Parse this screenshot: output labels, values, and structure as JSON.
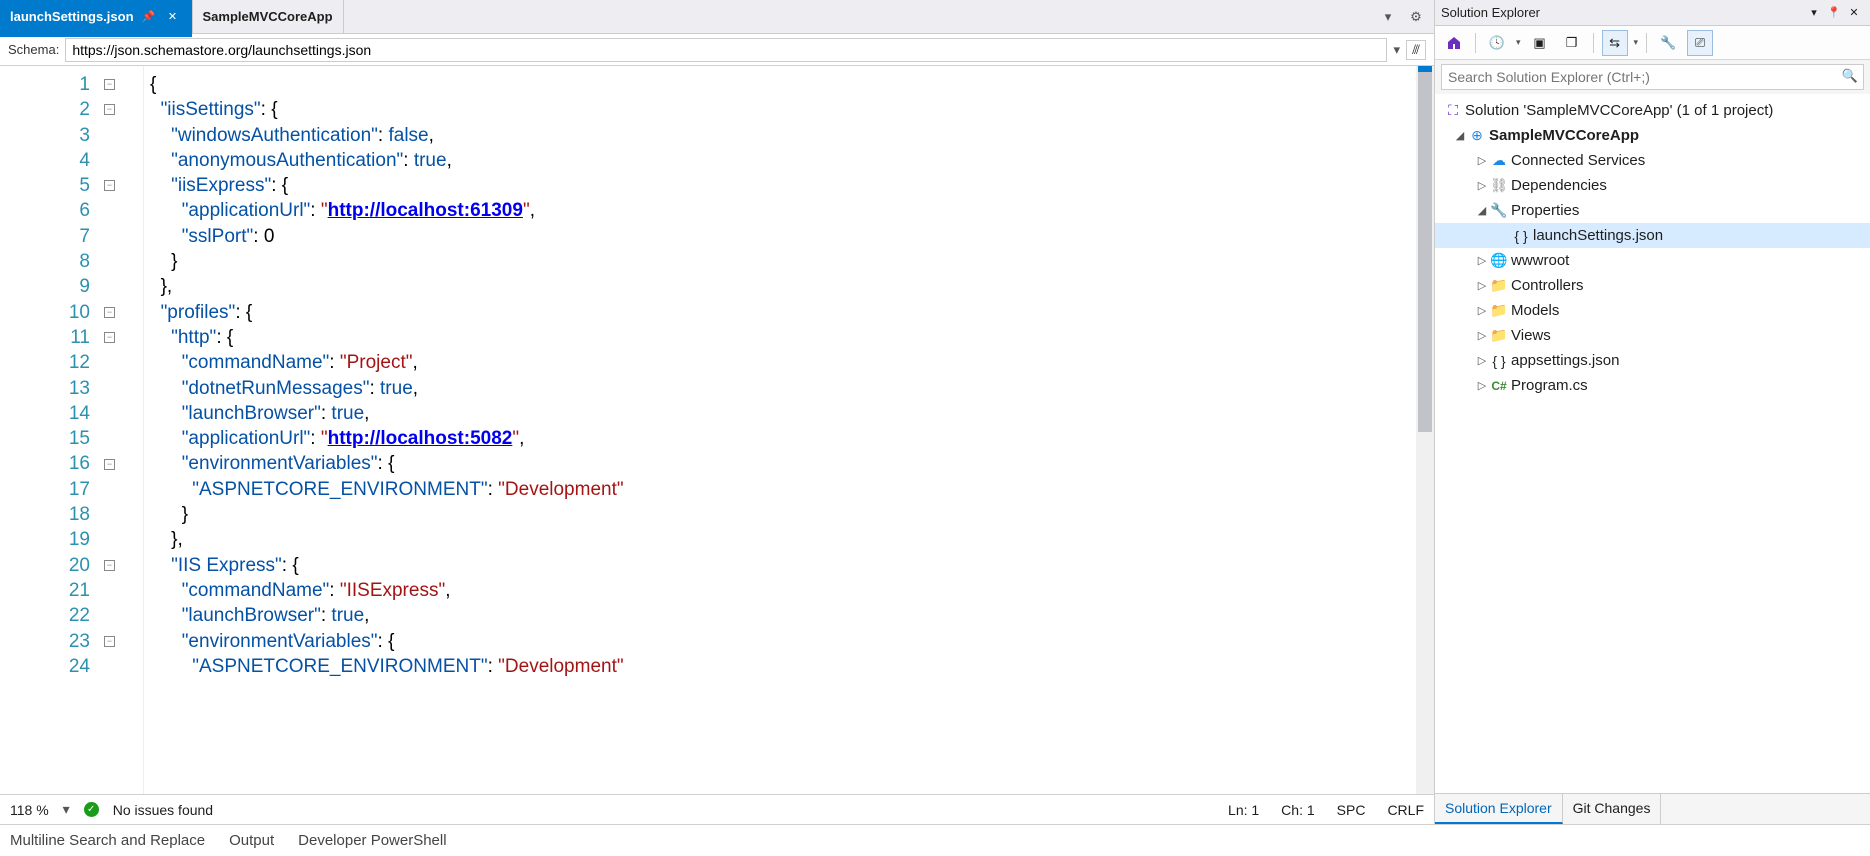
{
  "tabs": {
    "active": "launchSettings.json",
    "second": "SampleMVCCoreApp"
  },
  "schema": {
    "label": "Schema:",
    "value": "https://json.schemastore.org/launchsettings.json"
  },
  "code_lines": [
    "1",
    "2",
    "3",
    "4",
    "5",
    "6",
    "7",
    "8",
    "9",
    "10",
    "11",
    "12",
    "13",
    "14",
    "15",
    "16",
    "17",
    "18",
    "19",
    "20",
    "21",
    "22",
    "23",
    "24"
  ],
  "code_tokens": {
    "l2_key": "\"iisSettings\"",
    "l3_key": "\"windowsAuthentication\"",
    "l3_val": "false",
    "l4_key": "\"anonymousAuthentication\"",
    "l4_val": "true",
    "l5_key": "\"iisExpress\"",
    "l6_key": "\"applicationUrl\"",
    "l6_q": "\"",
    "l6_url": "http://localhost:61309",
    "l7_key": "\"sslPort\"",
    "l7_val": "0",
    "l10_key": "\"profiles\"",
    "l11_key": "\"http\"",
    "l12_key": "\"commandName\"",
    "l12_val": "\"Project\"",
    "l13_key": "\"dotnetRunMessages\"",
    "l13_val": "true",
    "l14_key": "\"launchBrowser\"",
    "l14_val": "true",
    "l15_key": "\"applicationUrl\"",
    "l15_q": "\"",
    "l15_url": "http://localhost:5082",
    "l16_key": "\"environmentVariables\"",
    "l17_key": "\"ASPNETCORE_ENVIRONMENT\"",
    "l17_val": "\"Development\"",
    "l20_key": "\"IIS Express\"",
    "l21_key": "\"commandName\"",
    "l21_val": "\"IISExpress\"",
    "l22_key": "\"launchBrowser\"",
    "l22_val": "true",
    "l23_key": "\"environmentVariables\"",
    "l24_key": "\"ASPNETCORE_ENVIRONMENT\"",
    "l24_val": "\"Development\""
  },
  "status": {
    "zoom": "118 %",
    "issues": "No issues found",
    "ln": "Ln: 1",
    "ch": "Ch: 1",
    "spc": "SPC",
    "crlf": "CRLF"
  },
  "bottom_tabs": [
    "Multiline Search and Replace",
    "Output",
    "Developer PowerShell"
  ],
  "explorer": {
    "title": "Solution Explorer",
    "search_placeholder": "Search Solution Explorer (Ctrl+;)",
    "solution": "Solution 'SampleMVCCoreApp' (1 of 1 project)",
    "project": "SampleMVCCoreApp",
    "nodes": {
      "connected": "Connected Services",
      "deps": "Dependencies",
      "props": "Properties",
      "launch": "launchSettings.json",
      "wwwroot": "wwwroot",
      "controllers": "Controllers",
      "models": "Models",
      "views": "Views",
      "appsettings": "appsettings.json",
      "program": "Program.cs"
    },
    "tabs": {
      "active": "Solution Explorer",
      "other": "Git Changes"
    }
  }
}
